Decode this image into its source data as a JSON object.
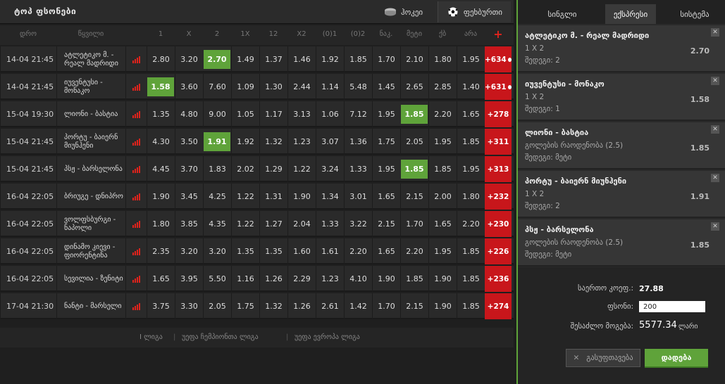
{
  "header": {
    "title": "ტოპ ფსონები",
    "sport_tabs": [
      {
        "label": "ჰოკეი",
        "icon": "hockey-puck-icon"
      },
      {
        "label": "ფეხბურთი",
        "icon": "soccer-ball-icon"
      }
    ]
  },
  "columns": [
    "დრო",
    "წყვილი",
    "1",
    "X",
    "2",
    "1X",
    "12",
    "X2",
    "(0)1",
    "(0)2",
    "ნაკ.",
    "მეტი",
    "ქბ",
    "არა",
    "+"
  ],
  "rows": [
    {
      "date": "14-04 21:45",
      "event": "ატლეტიკო მ. - რეალ მადრიდი",
      "odds": [
        "2.80",
        "3.20",
        "2.70",
        "1.49",
        "1.37",
        "1.46",
        "1.92",
        "1.85",
        "1.70",
        "2.10",
        "1.80",
        "1.95"
      ],
      "selected": 2,
      "more": "+634",
      "live": true
    },
    {
      "date": "14-04 21:45",
      "event": "იუვენტუსი - მონაკო",
      "odds": [
        "1.58",
        "3.60",
        "7.60",
        "1.09",
        "1.30",
        "2.44",
        "1.14",
        "5.48",
        "1.45",
        "2.65",
        "2.85",
        "1.40"
      ],
      "selected": 0,
      "more": "+631",
      "live": true
    },
    {
      "date": "15-04 19:30",
      "event": "ლიონი - ბასტია",
      "odds": [
        "1.35",
        "4.80",
        "9.00",
        "1.05",
        "1.17",
        "3.13",
        "1.06",
        "7.12",
        "1.95",
        "1.85",
        "2.20",
        "1.65"
      ],
      "selected": 9,
      "more": "+278",
      "live": false
    },
    {
      "date": "15-04 21:45",
      "event": "პორტუ - ბაიერნ მიუნჰენი",
      "odds": [
        "4.30",
        "3.50",
        "1.91",
        "1.92",
        "1.32",
        "1.23",
        "3.07",
        "1.36",
        "1.75",
        "2.05",
        "1.95",
        "1.85"
      ],
      "selected": 2,
      "more": "+311",
      "live": false
    },
    {
      "date": "15-04 21:45",
      "event": "პსჟ - ბარსელონა",
      "odds": [
        "4.45",
        "3.70",
        "1.83",
        "2.02",
        "1.29",
        "1.22",
        "3.24",
        "1.33",
        "1.95",
        "1.85",
        "1.85",
        "1.95"
      ],
      "selected": 9,
      "more": "+313",
      "live": false
    },
    {
      "date": "16-04 22:05",
      "event": "ბრიუგე - დნიპრო",
      "odds": [
        "1.90",
        "3.45",
        "4.25",
        "1.22",
        "1.31",
        "1.90",
        "1.34",
        "3.01",
        "1.65",
        "2.15",
        "2.00",
        "1.80"
      ],
      "selected": -1,
      "more": "+232",
      "live": false
    },
    {
      "date": "16-04 22:05",
      "event": "ვოლფსბურგი - ნაპოლი",
      "odds": [
        "1.80",
        "3.85",
        "4.35",
        "1.22",
        "1.27",
        "2.04",
        "1.33",
        "3.22",
        "2.15",
        "1.70",
        "1.65",
        "2.20"
      ],
      "selected": -1,
      "more": "+230",
      "live": false
    },
    {
      "date": "16-04 22:05",
      "event": "დინამო კიევი - ფიორენტინა",
      "odds": [
        "2.35",
        "3.20",
        "3.20",
        "1.35",
        "1.35",
        "1.60",
        "1.61",
        "2.20",
        "1.65",
        "2.20",
        "1.95",
        "1.85"
      ],
      "selected": -1,
      "more": "+226",
      "live": false
    },
    {
      "date": "16-04 22:05",
      "event": "სევილია - ზენიტი",
      "odds": [
        "1.65",
        "3.95",
        "5.50",
        "1.16",
        "1.26",
        "2.29",
        "1.23",
        "4.10",
        "1.90",
        "1.85",
        "1.90",
        "1.85"
      ],
      "selected": -1,
      "more": "+236",
      "live": false
    },
    {
      "date": "17-04 21:30",
      "event": "ნანტი - მარსელი",
      "odds": [
        "3.75",
        "3.30",
        "2.05",
        "1.75",
        "1.32",
        "1.26",
        "2.61",
        "1.42",
        "1.70",
        "2.15",
        "1.90",
        "1.85"
      ],
      "selected": -1,
      "more": "+274",
      "live": false
    }
  ],
  "leagues": [
    "I ლიგა",
    "უეფა ჩემპიონთა ლიგა",
    "უეფა ევროპა ლიგა"
  ],
  "betslip": {
    "tabs": [
      "სინგლი",
      "ექსპრესი",
      "სისტემა"
    ],
    "bets": [
      {
        "name": "ატლეტიკო მ. - რეალ მადრიდი",
        "market": "1 X 2",
        "result": "შედეგი: 2",
        "odd": "2.70"
      },
      {
        "name": "იუვენტუსი - მონაკო",
        "market": "1 X 2",
        "result": "შედეგი: 1",
        "odd": "1.58"
      },
      {
        "name": "ლიონი - ბასტია",
        "market": "გოლების რაოდენობა (2.5)",
        "result": "შედეგი: მეტი",
        "odd": "1.85"
      },
      {
        "name": "პორტუ - ბაიერნ მიუნჰენი",
        "market": "1 X 2",
        "result": "შედეგი: 2",
        "odd": "1.91"
      },
      {
        "name": "პსჟ - ბარსელონა",
        "market": "გოლების რაოდენობა (2.5)",
        "result": "შედეგი: მეტი",
        "odd": "1.85"
      }
    ],
    "total_odds_label": "საერთო კოეფ.:",
    "total_odds": "27.88",
    "stake_label": "ფსონი:",
    "stake_value": "200",
    "possible_win_label": "შესაძლო მოგება:",
    "possible_win": "5577.34",
    "currency": "ლარი",
    "clear_label": "გასუფთავება",
    "place_label": "დადება"
  }
}
